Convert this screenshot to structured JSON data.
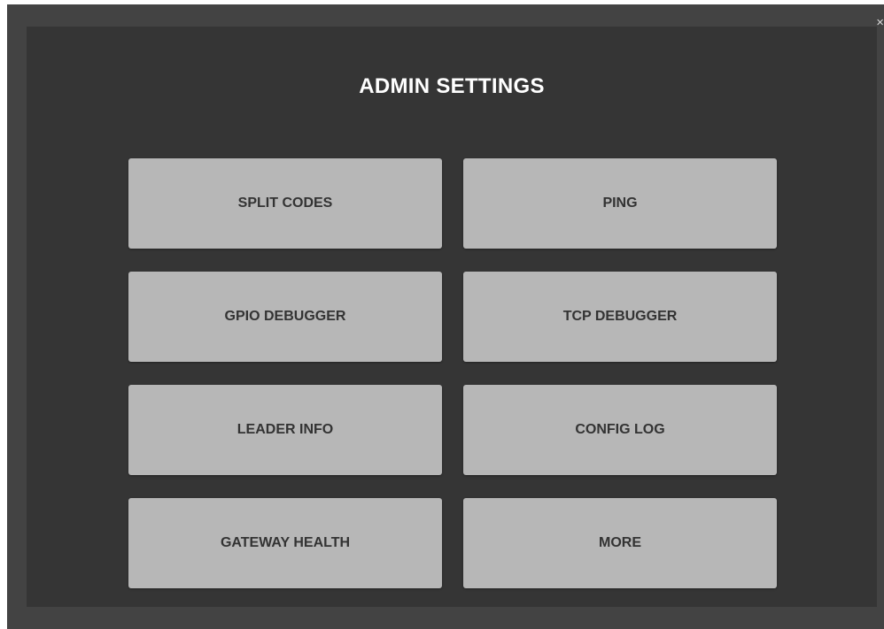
{
  "dialog": {
    "title": "ADMIN SETTINGS",
    "close_label": "×",
    "buttons": [
      {
        "label": "SPLIT CODES"
      },
      {
        "label": "PING"
      },
      {
        "label": "GPIO DEBUGGER"
      },
      {
        "label": "TCP DEBUGGER"
      },
      {
        "label": "LEADER INFO"
      },
      {
        "label": "CONFIG LOG"
      },
      {
        "label": "GATEWAY HEALTH"
      },
      {
        "label": "MORE"
      }
    ]
  },
  "colors": {
    "outer_frame": "#434343",
    "panel": "#353535",
    "button": "#b7b7b7",
    "button_text": "#333333",
    "title_text": "#ffffff"
  }
}
